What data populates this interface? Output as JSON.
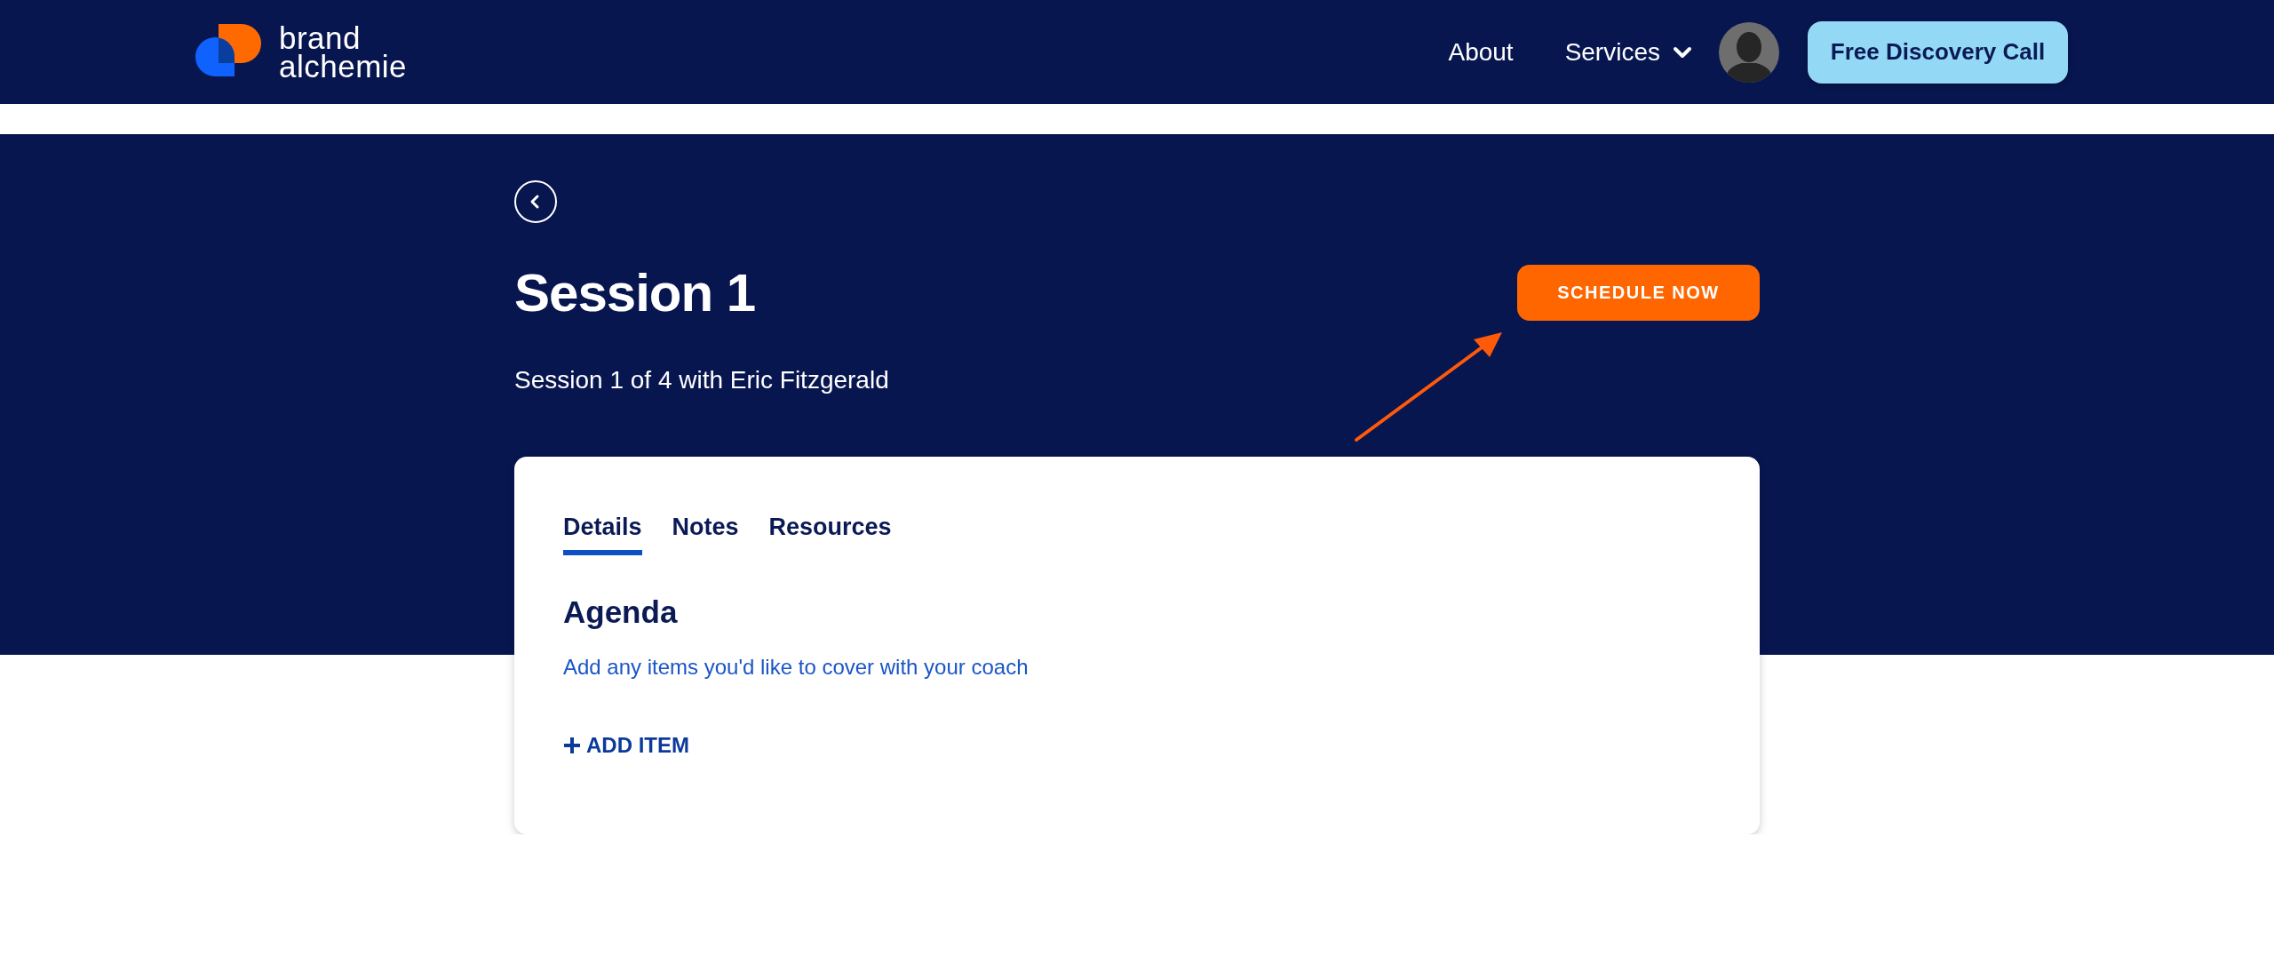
{
  "header": {
    "logo": {
      "line_1": "brand",
      "line_2": "alchemie"
    },
    "nav": [
      {
        "label": "About",
        "kind": "link"
      },
      {
        "label": "Services",
        "kind": "dropdown"
      }
    ],
    "cta": "Free Discovery Call"
  },
  "session": {
    "title": "Session 1",
    "subtitle": "Session 1 of 4 with Eric Fitzgerald",
    "action": "SCHEDULE NOW"
  },
  "tabs": [
    {
      "label": "Details",
      "selected": true
    },
    {
      "label": "Notes",
      "selected": false
    },
    {
      "label": "Resources",
      "selected": false
    }
  ],
  "agenda": {
    "heading": "Agenda",
    "hint": "Add any items you'd like to cover with your coach",
    "add": "ADD ITEM"
  }
}
